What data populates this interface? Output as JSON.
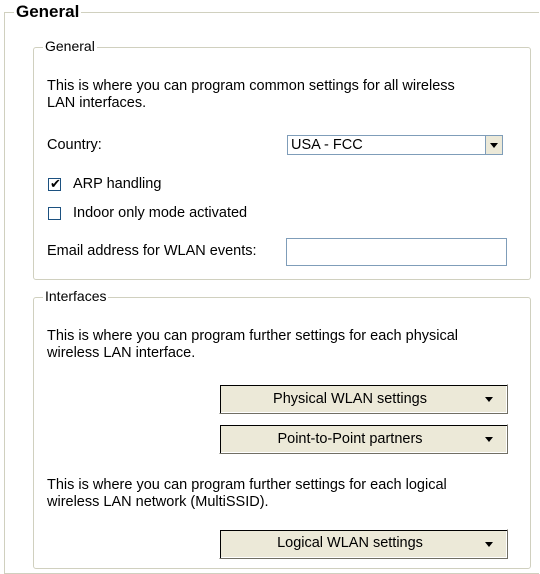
{
  "outer": {
    "title": "General"
  },
  "general": {
    "legend": "General",
    "description_line1": "This is where you can program common settings for all wireless",
    "description_line2": "LAN interfaces.",
    "country_label": "Country:",
    "country_value": "USA - FCC",
    "arp": {
      "label": "ARP handling",
      "checked": true
    },
    "indoor": {
      "label": "Indoor only mode activated",
      "checked": false
    },
    "email_label": "Email address for WLAN events:",
    "email_value": ""
  },
  "interfaces": {
    "legend": "Interfaces",
    "physical_desc_line1": "This is where you can program further settings for each physical",
    "physical_desc_line2": "wireless LAN interface.",
    "physical_button": "Physical WLAN settings",
    "p2p_button": "Point-to-Point partners",
    "logical_desc_line1": "This is where you can program further settings for each logical",
    "logical_desc_line2": "wireless LAN network (MultiSSID).",
    "logical_button": "Logical WLAN settings"
  },
  "icons": {
    "dropdown": "chevron-down-icon",
    "check": "checkmark-icon"
  }
}
